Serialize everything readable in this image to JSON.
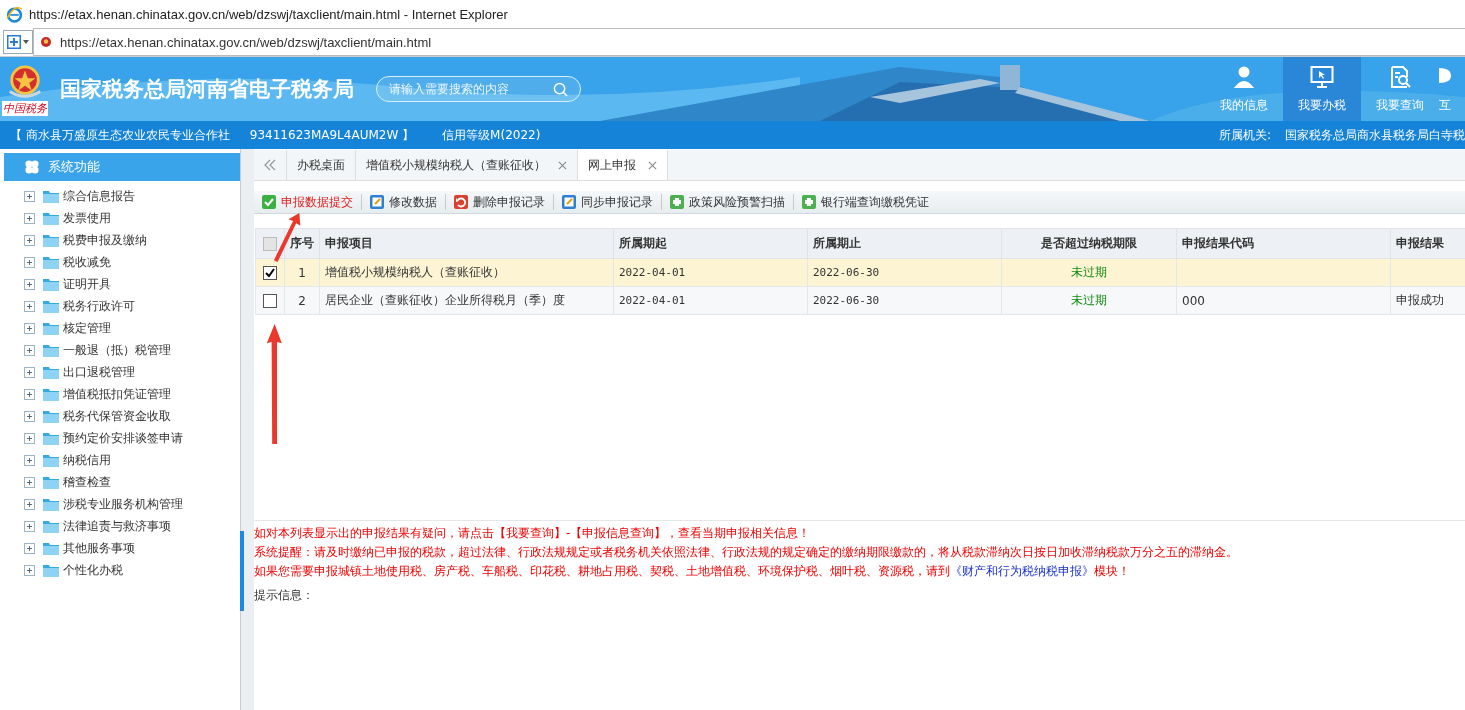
{
  "window": {
    "title": "https://etax.henan.chinatax.gov.cn/web/dzswj/taxclient/main.html - Internet Explorer"
  },
  "address_bar": {
    "url": "https://etax.henan.chinatax.gov.cn/web/dzswj/taxclient/main.html"
  },
  "header": {
    "logo_caption": "中国税务",
    "title": "国家税务总局河南省电子税务局",
    "search": {
      "placeholder": "请输入需要搜索的内容"
    },
    "nav": [
      {
        "label": "我的信息",
        "kind": "person",
        "selected": false
      },
      {
        "label": "我要办税",
        "kind": "monitor",
        "selected": true
      },
      {
        "label": "我要查询",
        "kind": "query",
        "selected": false
      },
      {
        "label": "互",
        "kind": "chat",
        "selected": false
      }
    ]
  },
  "info_bar": {
    "taxpayer": "【 商水县万盛原生态农业农民专业合作社",
    "tax_id": "93411623MA9L4AUM2W 】",
    "credit": "信用等级M(2022)",
    "authority_label": "所属机关:",
    "authority": "国家税务总局商水县税务局白寺税"
  },
  "sidebar": {
    "title": "系统功能",
    "items": [
      {
        "label": "综合信息报告"
      },
      {
        "label": "发票使用"
      },
      {
        "label": "税费申报及缴纳"
      },
      {
        "label": "税收减免"
      },
      {
        "label": "证明开具"
      },
      {
        "label": "税务行政许可"
      },
      {
        "label": "核定管理"
      },
      {
        "label": "一般退（抵）税管理"
      },
      {
        "label": "出口退税管理"
      },
      {
        "label": "增值税抵扣凭证管理"
      },
      {
        "label": "税务代保管资金收取"
      },
      {
        "label": "预约定价安排谈签申请"
      },
      {
        "label": "纳税信用"
      },
      {
        "label": "稽查检查"
      },
      {
        "label": "涉税专业服务机构管理"
      },
      {
        "label": "法律追责与救济事项"
      },
      {
        "label": "其他服务事项"
      },
      {
        "label": "个性化办税"
      }
    ]
  },
  "tabs": [
    {
      "label": "办税桌面",
      "closable": false,
      "selected": false
    },
    {
      "label": "增值税小规模纳税人（查账征收）",
      "closable": true,
      "selected": false
    },
    {
      "label": "网上申报",
      "closable": true,
      "selected": true
    }
  ],
  "toolbar": [
    {
      "label": "申报数据提交",
      "kind": "submit"
    },
    {
      "label": "修改数据",
      "kind": "edit"
    },
    {
      "label": "删除申报记录",
      "kind": "delete"
    },
    {
      "label": "同步申报记录",
      "kind": "edit"
    },
    {
      "label": "政策风险预警扫描",
      "kind": "plugin"
    },
    {
      "label": "银行端查询缴税凭证",
      "kind": "plugin"
    }
  ],
  "table": {
    "select_all": {
      "checked": false
    },
    "columns": [
      "序号",
      "申报项目",
      "所属期起",
      "所属期止",
      "是否超过纳税期限",
      "申报结果代码",
      "申报结果"
    ],
    "rows": [
      {
        "checked": true,
        "selected": true,
        "cells": [
          "1",
          "增值税小规模纳税人（查账征收）",
          "2022-04-01",
          "2022-06-30",
          "未过期",
          "",
          ""
        ]
      },
      {
        "checked": false,
        "selected": false,
        "cells": [
          "2",
          "居民企业（查账征收）企业所得税月（季）度",
          "2022-04-01",
          "2022-06-30",
          "未过期",
          "000",
          "申报成功"
        ]
      }
    ]
  },
  "notes": [
    {
      "text": "如对本列表显示出的申报结果有疑问，请点击【我要查询】-【申报信息查询】，查看当期申报相关信息！"
    },
    {
      "text": "系统提醒：请及时缴纳已申报的税款，超过法律、行政法规规定或者税务机关依照法律、行政法规的规定确定的缴纳期限缴款的，将从税款滞纳次日按日加收滞纳税款万分之五的滞纳金。"
    },
    {
      "text": "如果您需要申报城镇土地使用税、房产税、车船税、印花税、耕地占用税、契税、土地增值税、环境保护税、烟叶税、资源税，请到",
      "link": "《财产和行为税纳税申报》",
      "after": "模块！"
    }
  ],
  "hint_label": "提示信息："
}
